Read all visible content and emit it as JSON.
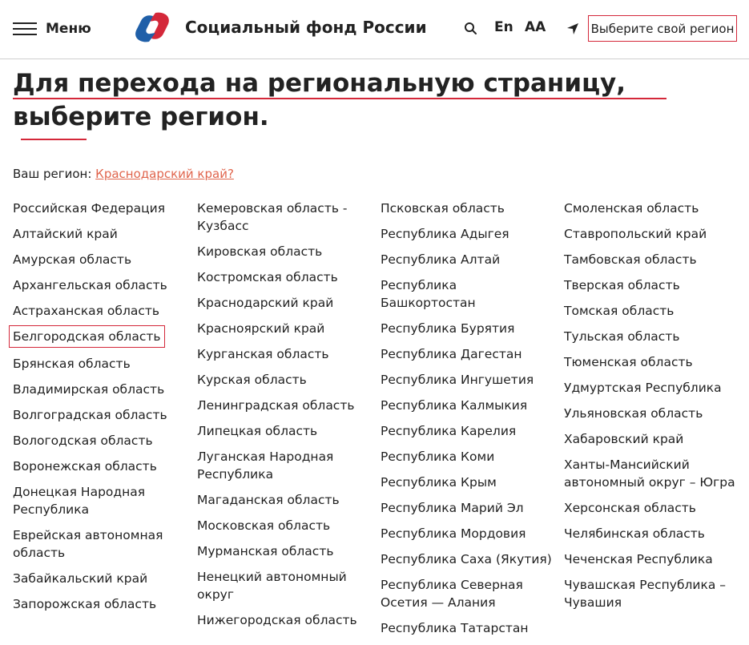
{
  "header": {
    "menu_label": "Меню",
    "site_title": "Социальный фонд России",
    "lang_label": "En",
    "font_size_label": "AA",
    "region_button_label": "Выберите свой регион",
    "colors": {
      "brand_red": "#d4283a",
      "brand_blue": "#1f5fa8",
      "link": "#e0654d"
    }
  },
  "heading": "Для перехода на региональную страницу, выберите регион.",
  "your_region": {
    "prefix": "Ваш регион: ",
    "link": "Краснодарский край?"
  },
  "columns": [
    [
      "Российская Федерация",
      "Алтайский край",
      "Амурская область",
      "Архангельская область",
      "Астраханская область",
      "Белгородская область",
      "Брянская область",
      "Владимирская область",
      "Волгоградская область",
      "Вологодская область",
      "Воронежская область",
      "Донецкая Народная Республика",
      "Еврейская автономная область",
      "Забайкальский край",
      "Запорожская область"
    ],
    [
      "Кемеровская область - Кузбасс",
      "Кировская область",
      "Костромская область",
      "Краснодарский край",
      "Красноярский край",
      "Курганская область",
      "Курская область",
      "Ленинградская область",
      "Липецкая область",
      "Луганская Народная Республика",
      "Магаданская область",
      "Московская область",
      "Мурманская область",
      "Ненецкий автономный округ",
      "Нижегородская область"
    ],
    [
      "Псковская область",
      "Республика Адыгея",
      "Республика Алтай",
      "Республика Башкортостан",
      "Республика Бурятия",
      "Республика Дагестан",
      "Республика Ингушетия",
      "Республика Калмыкия",
      "Республика Карелия",
      "Республика Коми",
      "Республика Крым",
      "Республика Марий Эл",
      "Республика Мордовия",
      "Республика Саха (Якутия)",
      "Республика Северная Осетия — Алания",
      "Республика Татарстан"
    ],
    [
      "Смоленская область",
      "Ставропольский край",
      "Тамбовская область",
      "Тверская область",
      "Томская область",
      "Тульская область",
      "Тюменская область",
      "Удмуртская Республика",
      "Ульяновская область",
      "Хабаровский край",
      "Ханты-Мансийский автономный округ – Югра",
      "Херсонская область",
      "Челябинская область",
      "Чеченская Республика",
      "Чувашская Республика – Чувашия"
    ]
  ],
  "highlighted_region": "Белгородская область"
}
